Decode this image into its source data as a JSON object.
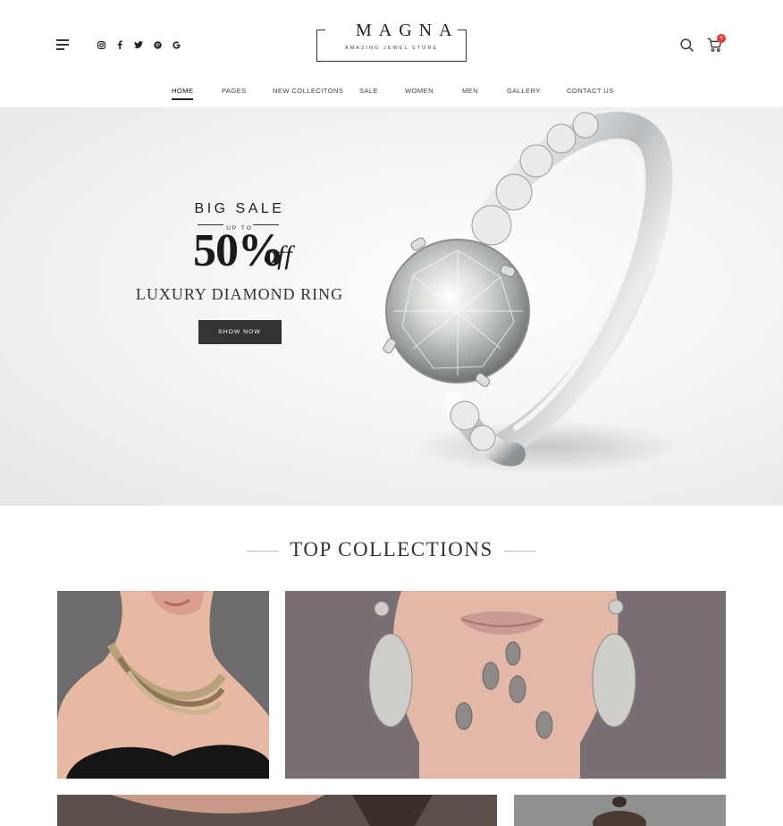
{
  "header": {
    "menu_icon": "hamburger-menu-icon",
    "social": [
      {
        "name": "instagram",
        "icon": "instagram-icon"
      },
      {
        "name": "facebook",
        "icon": "facebook-icon"
      },
      {
        "name": "twitter",
        "icon": "twitter-icon"
      },
      {
        "name": "pinterest",
        "icon": "pinterest-icon"
      },
      {
        "name": "google",
        "icon": "google-icon"
      }
    ],
    "logo": {
      "brand": "MAGNA",
      "tagline": "AMAZING JEWEL STORE"
    },
    "search_icon": "search-icon",
    "cart": {
      "icon": "cart-icon",
      "count": "0"
    }
  },
  "nav": {
    "items": [
      {
        "label": "HOME",
        "active": true
      },
      {
        "label": "PAGES"
      },
      {
        "label": "NEW COLLECITONS"
      },
      {
        "label": "SALE"
      },
      {
        "label": "WOMEN"
      },
      {
        "label": "MEN"
      },
      {
        "label": "GALLERY"
      },
      {
        "label": "CONTACT US"
      }
    ]
  },
  "hero": {
    "headline": "BIG SALE",
    "up_to": "UP TO",
    "discount": "50%",
    "off": "off",
    "product": "LUXURY DIAMOND RING",
    "cta": "SHOW NOW"
  },
  "collections": {
    "title": "TOP COLLECTIONS"
  },
  "colors": {
    "accent": "#333333",
    "badge": "#e53935",
    "hero_bg": "#f1f1f1"
  }
}
